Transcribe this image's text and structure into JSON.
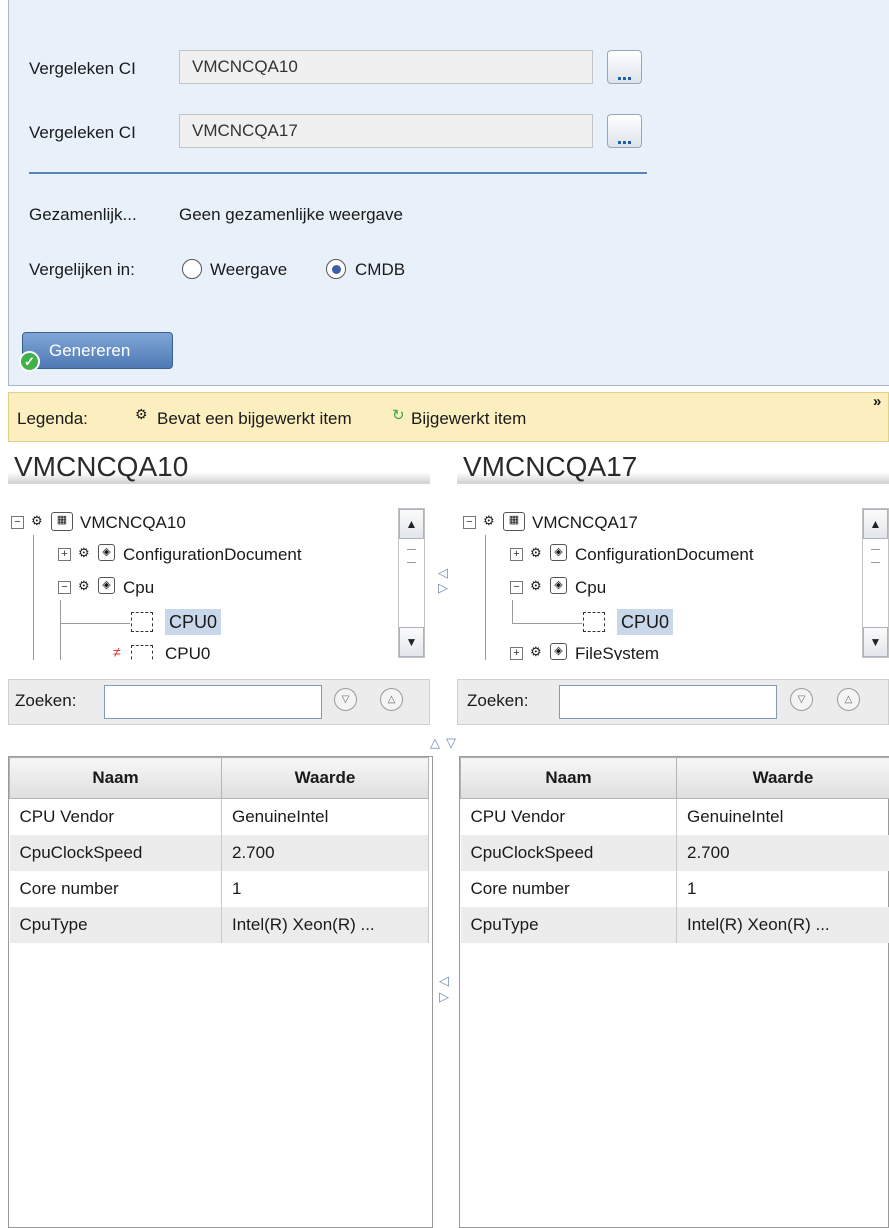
{
  "form": {
    "compared_ci_label": "Vergeleken CI",
    "ci1_value": "VMCNCQA10",
    "ci2_value": "VMCNCQA17",
    "shared_label": "Gezamenlijk...",
    "shared_value": "Geen gezamenlijke weergave",
    "compare_in_label": "Vergelijken in:",
    "radio_view_label": "Weergave",
    "radio_cmdb_label": "CMDB",
    "selected_option": "CMDB",
    "generate_button": "Genereren"
  },
  "legend": {
    "label": "Legenda:",
    "item1": "Bevat een bijgewerkt item",
    "item2": "Bijgewerkt item",
    "expand": "»"
  },
  "left": {
    "header": "VMCNCQA10",
    "tree": {
      "root": "VMCNCQA10",
      "n1": "ConfigurationDocument",
      "n2": "Cpu",
      "n3": "CPU0",
      "n4": "CPU0"
    },
    "search_label": "Zoeken:",
    "table": {
      "col_name": "Naam",
      "col_value": "Waarde",
      "rows": [
        {
          "name": "CPU Vendor",
          "value": "GenuineIntel"
        },
        {
          "name": "CpuClockSpeed",
          "value": "2.700"
        },
        {
          "name": "Core number",
          "value": "1"
        },
        {
          "name": "CpuType",
          "value": "Intel(R) Xeon(R) ..."
        }
      ]
    }
  },
  "right": {
    "header": "VMCNCQA17",
    "tree": {
      "root": "VMCNCQA17",
      "n1": "ConfigurationDocument",
      "n2": "Cpu",
      "n3": "CPU0",
      "n4": "FileSystem"
    },
    "search_label": "Zoeken:",
    "table": {
      "col_name": "Naam",
      "col_value": "Waarde",
      "rows": [
        {
          "name": "CPU Vendor",
          "value": "GenuineIntel"
        },
        {
          "name": "CpuClockSpeed",
          "value": "2.700"
        },
        {
          "name": "Core number",
          "value": "1"
        },
        {
          "name": "CpuType",
          "value": "Intel(R) Xeon(R) ..."
        }
      ]
    }
  },
  "colors": {
    "panel_bg": "#e8f0fa",
    "legend_bg": "#fbefbf",
    "selected_bg": "#c9d7ea",
    "accent": "#4e79b4"
  }
}
